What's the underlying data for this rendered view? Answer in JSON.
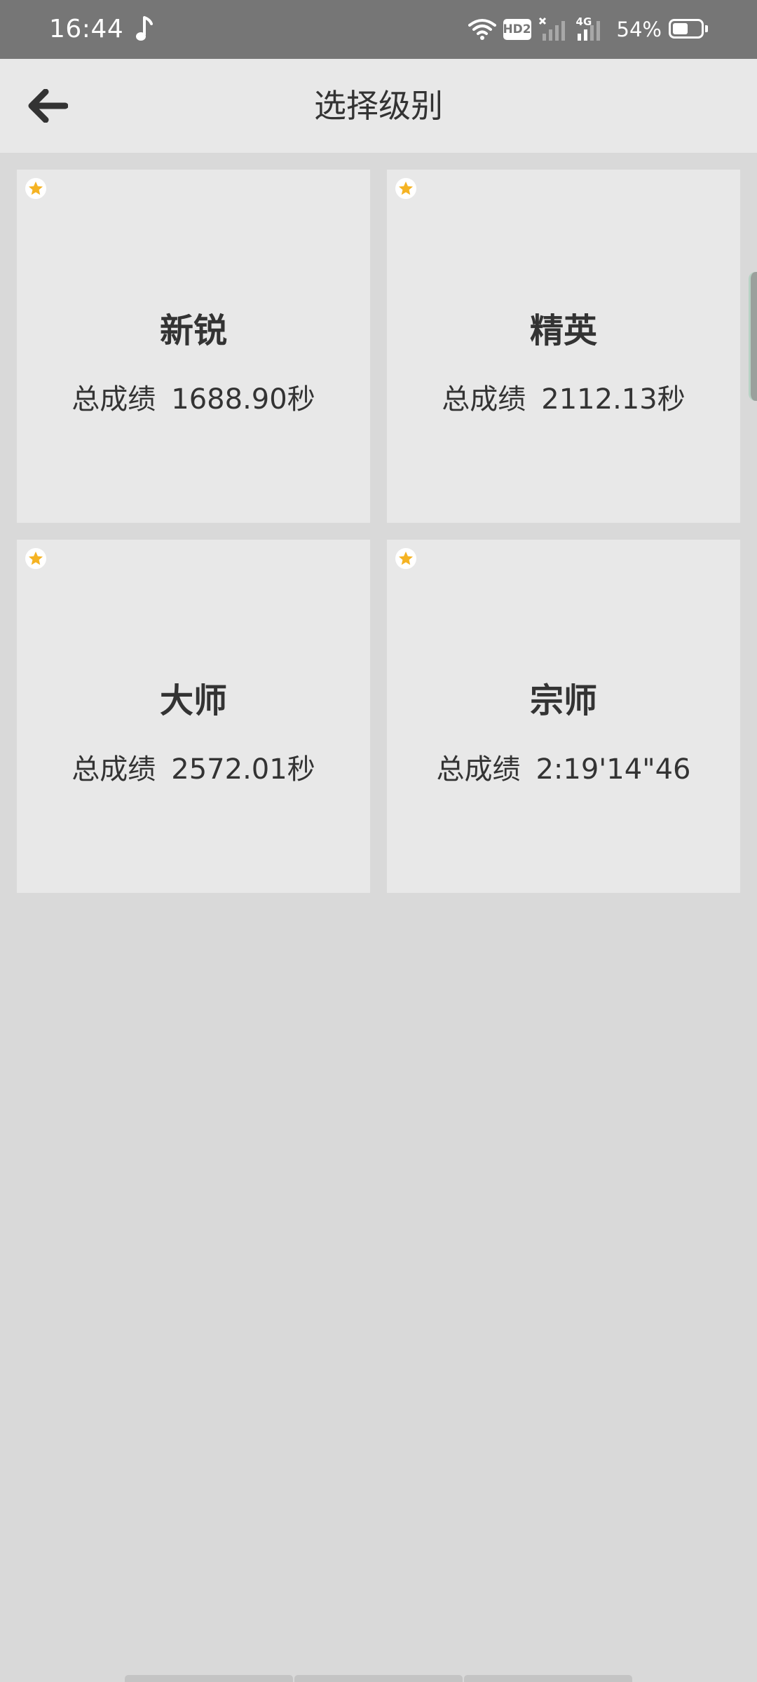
{
  "status_bar": {
    "time": "16:44",
    "hd_label": "HD2",
    "network_label": "4G",
    "battery_percent": "54%",
    "battery_level": 0.54
  },
  "header": {
    "title": "选择级别"
  },
  "levels": [
    {
      "name": "新锐",
      "score_label": "总成绩",
      "score": "1688.90秒"
    },
    {
      "name": "精英",
      "score_label": "总成绩",
      "score": "2112.13秒"
    },
    {
      "name": "大师",
      "score_label": "总成绩",
      "score": "2572.01秒"
    },
    {
      "name": "宗师",
      "score_label": "总成绩",
      "score": "2:19'14\"46"
    }
  ],
  "colors": {
    "star": "#f5b323",
    "background": "#d9d9d9",
    "card": "#e8e8e8",
    "status_bar": "#767676",
    "text": "#333333"
  }
}
